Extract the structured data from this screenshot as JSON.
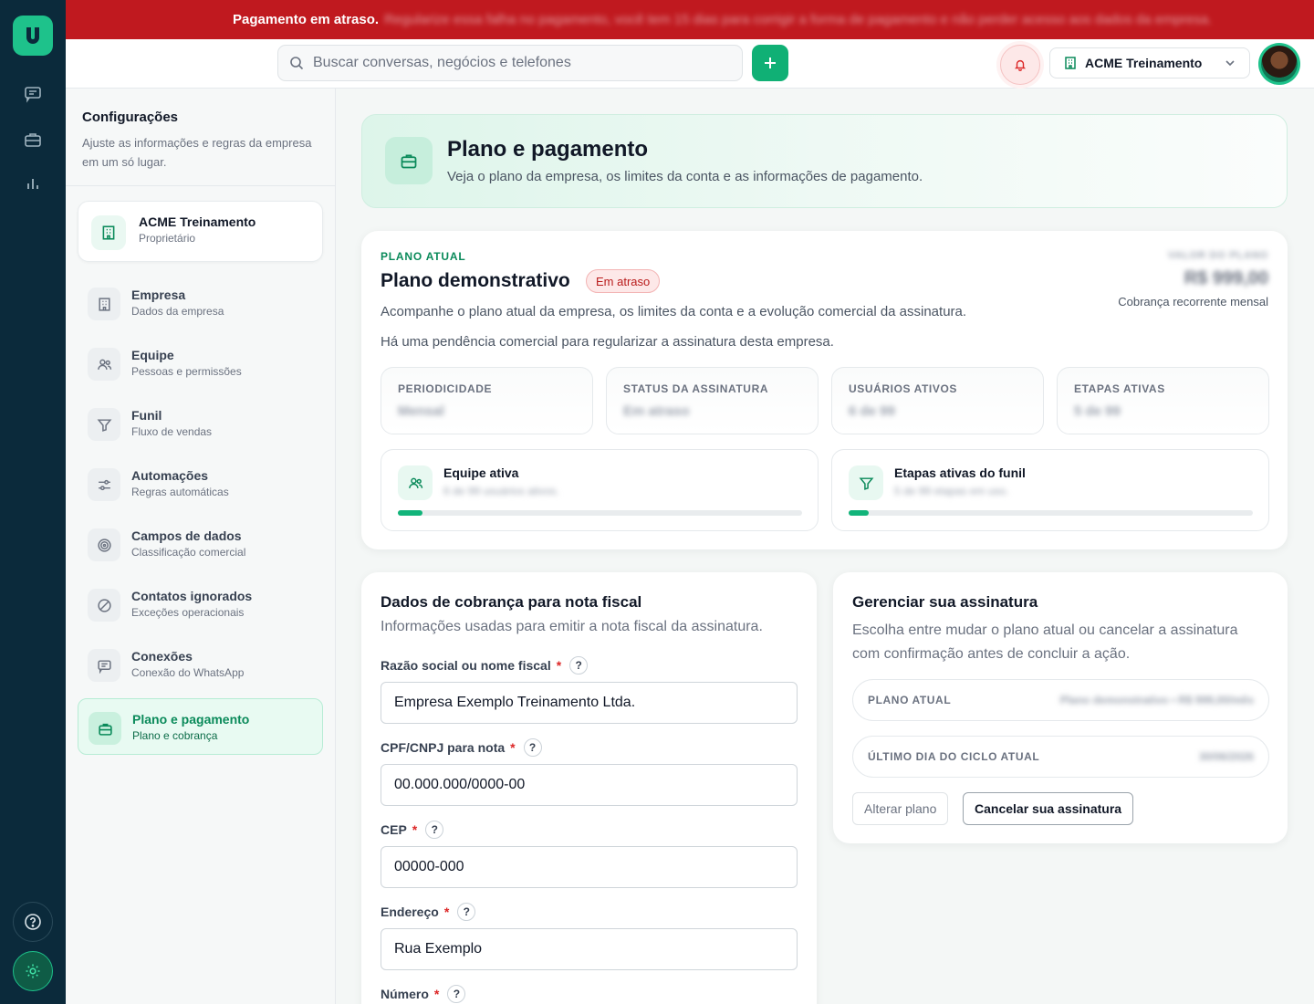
{
  "banner": {
    "bold": "Pagamento em atraso.",
    "rest": "Regularize essa falha no pagamento, você tem 15 dias para corrigir a forma de pagamento e não perder acesso aos dados da empresa."
  },
  "topbar": {
    "search_placeholder": "Buscar conversas, negócios e telefones",
    "company": "ACME Treinamento"
  },
  "sidebar": {
    "title": "Configurações",
    "subtitle": "Ajuste as informações e regras da empresa em um só lugar.",
    "org": {
      "name": "ACME Treinamento",
      "role": "Proprietário"
    },
    "items": [
      {
        "label": "Empresa",
        "sub": "Dados da empresa",
        "icon": "building-icon"
      },
      {
        "label": "Equipe",
        "sub": "Pessoas e permissões",
        "icon": "users-icon"
      },
      {
        "label": "Funil",
        "sub": "Fluxo de vendas",
        "icon": "filter-icon"
      },
      {
        "label": "Automações",
        "sub": "Regras automáticas",
        "icon": "sliders-icon"
      },
      {
        "label": "Campos de dados",
        "sub": "Classificação comercial",
        "icon": "target-icon"
      },
      {
        "label": "Contatos ignorados",
        "sub": "Exceções operacionais",
        "icon": "ban-icon"
      },
      {
        "label": "Conexões",
        "sub": "Conexão do WhatsApp",
        "icon": "chat-icon"
      },
      {
        "label": "Plano e pagamento",
        "sub": "Plano e cobrança",
        "icon": "briefcase-icon"
      }
    ]
  },
  "hero": {
    "title": "Plano e pagamento",
    "subtitle": "Veja o plano da empresa, os limites da conta e as informações de pagamento."
  },
  "plan": {
    "eyebrow": "PLANO ATUAL",
    "name": "Plano demonstrativo",
    "badge": "Em atraso",
    "desc1": "Acompanhe o plano atual da empresa, os limites da conta e a evolução comercial da assinatura.",
    "desc2": "Há uma pendência comercial para regularizar a assinatura desta empresa.",
    "value_label": "VALOR DO PLANO",
    "value": "R$ 999,00",
    "recurrence": "Cobrança recorrente mensal",
    "stats": [
      {
        "label": "PERIODICIDADE",
        "value": "Mensal"
      },
      {
        "label": "STATUS DA ASSINATURA",
        "value": "Em atraso"
      },
      {
        "label": "USUÁRIOS ATIVOS",
        "value": "6 de 99"
      },
      {
        "label": "ETAPAS ATIVAS",
        "value": "5 de 99"
      }
    ],
    "usage": [
      {
        "title": "Equipe ativa",
        "sub": "6 de 99 usuários ativos.",
        "percent": 6
      },
      {
        "title": "Etapas ativas do funil",
        "sub": "5 de 99 etapas em uso.",
        "percent": 5
      }
    ]
  },
  "billing": {
    "title": "Dados de cobrança para nota fiscal",
    "subtitle": "Informações usadas para emitir a nota fiscal da assinatura.",
    "fields": [
      {
        "label": "Razão social ou nome fiscal",
        "value": "Empresa Exemplo Treinamento Ltda."
      },
      {
        "label": "CPF/CNPJ para nota",
        "value": "00.000.000/0000-00"
      },
      {
        "label": "CEP",
        "value": "00000-000"
      },
      {
        "label": "Endereço",
        "value": "Rua Exemplo"
      },
      {
        "label": "Número",
        "value": ""
      }
    ]
  },
  "manage": {
    "title": "Gerenciar sua assinatura",
    "subtitle": "Escolha entre mudar o plano atual ou cancelar a assinatura com confirmação antes de concluir a ação.",
    "rows": [
      {
        "label": "PLANO ATUAL",
        "value": "Plano demonstrativo • R$ 999,00/mês"
      },
      {
        "label": "ÚLTIMO DIA DO CICLO ATUAL",
        "value": "30/06/2026"
      }
    ],
    "change_label": "Alterar plano",
    "cancel_label": "Cancelar sua assinatura"
  }
}
